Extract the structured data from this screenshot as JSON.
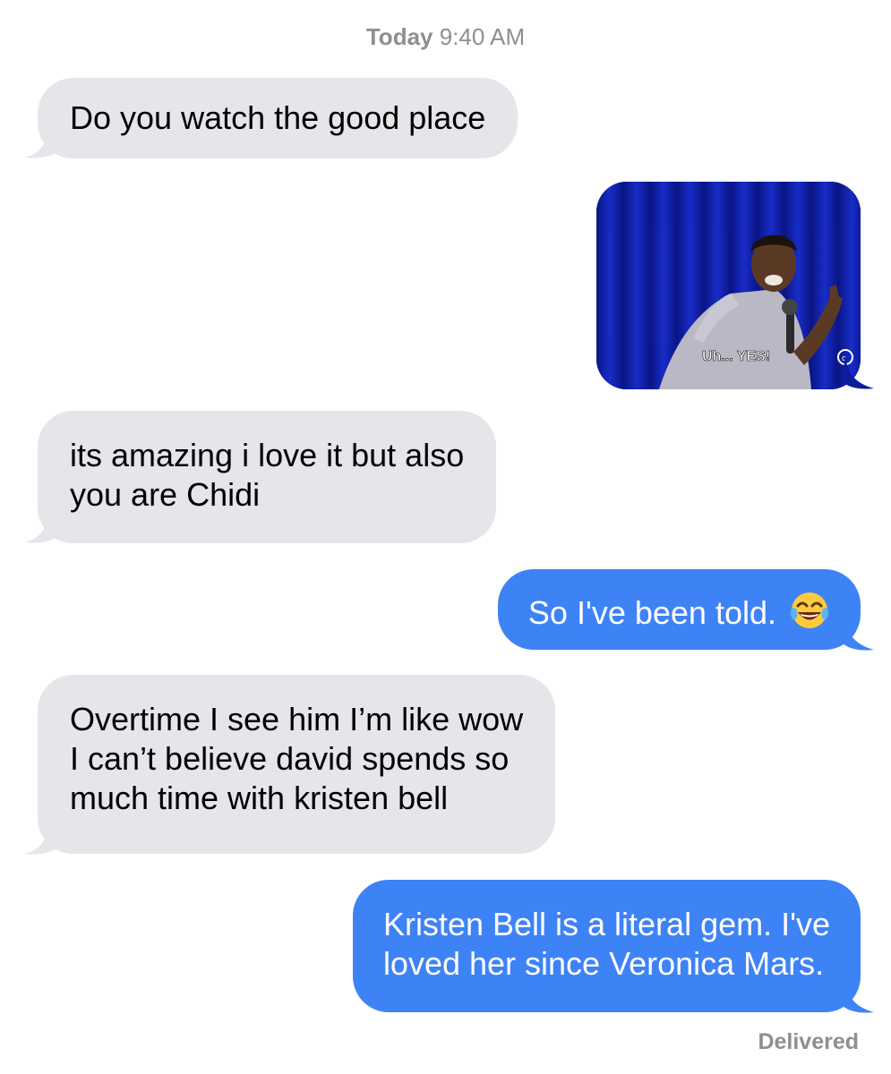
{
  "timestamp": {
    "day": "Today",
    "time": "9:40 AM"
  },
  "messages": [
    {
      "direction": "incoming",
      "lines": [
        "Do you watch the good place"
      ]
    },
    {
      "direction": "outgoing",
      "type": "gif",
      "caption": "Uh... YES!"
    },
    {
      "direction": "incoming",
      "lines": [
        "its amazing i love it but also",
        "you are Chidi"
      ]
    },
    {
      "direction": "outgoing",
      "lines": [
        "So I've been told."
      ],
      "emoji": "face-with-tears-of-joy-icon"
    },
    {
      "direction": "incoming",
      "lines": [
        "Overtime I see him I’m like wow",
        "I can’t believe david spends so",
        "much time with kristen bell"
      ]
    },
    {
      "direction": "outgoing",
      "lines": [
        "Kristen Bell is a literal gem. I've",
        "loved her since Veronica Mars."
      ]
    }
  ],
  "status": "Delivered",
  "colors": {
    "incoming_bubble": "#e5e5ea",
    "outgoing_bubble": "#3e83f6",
    "meta_text": "#8e8e93"
  }
}
